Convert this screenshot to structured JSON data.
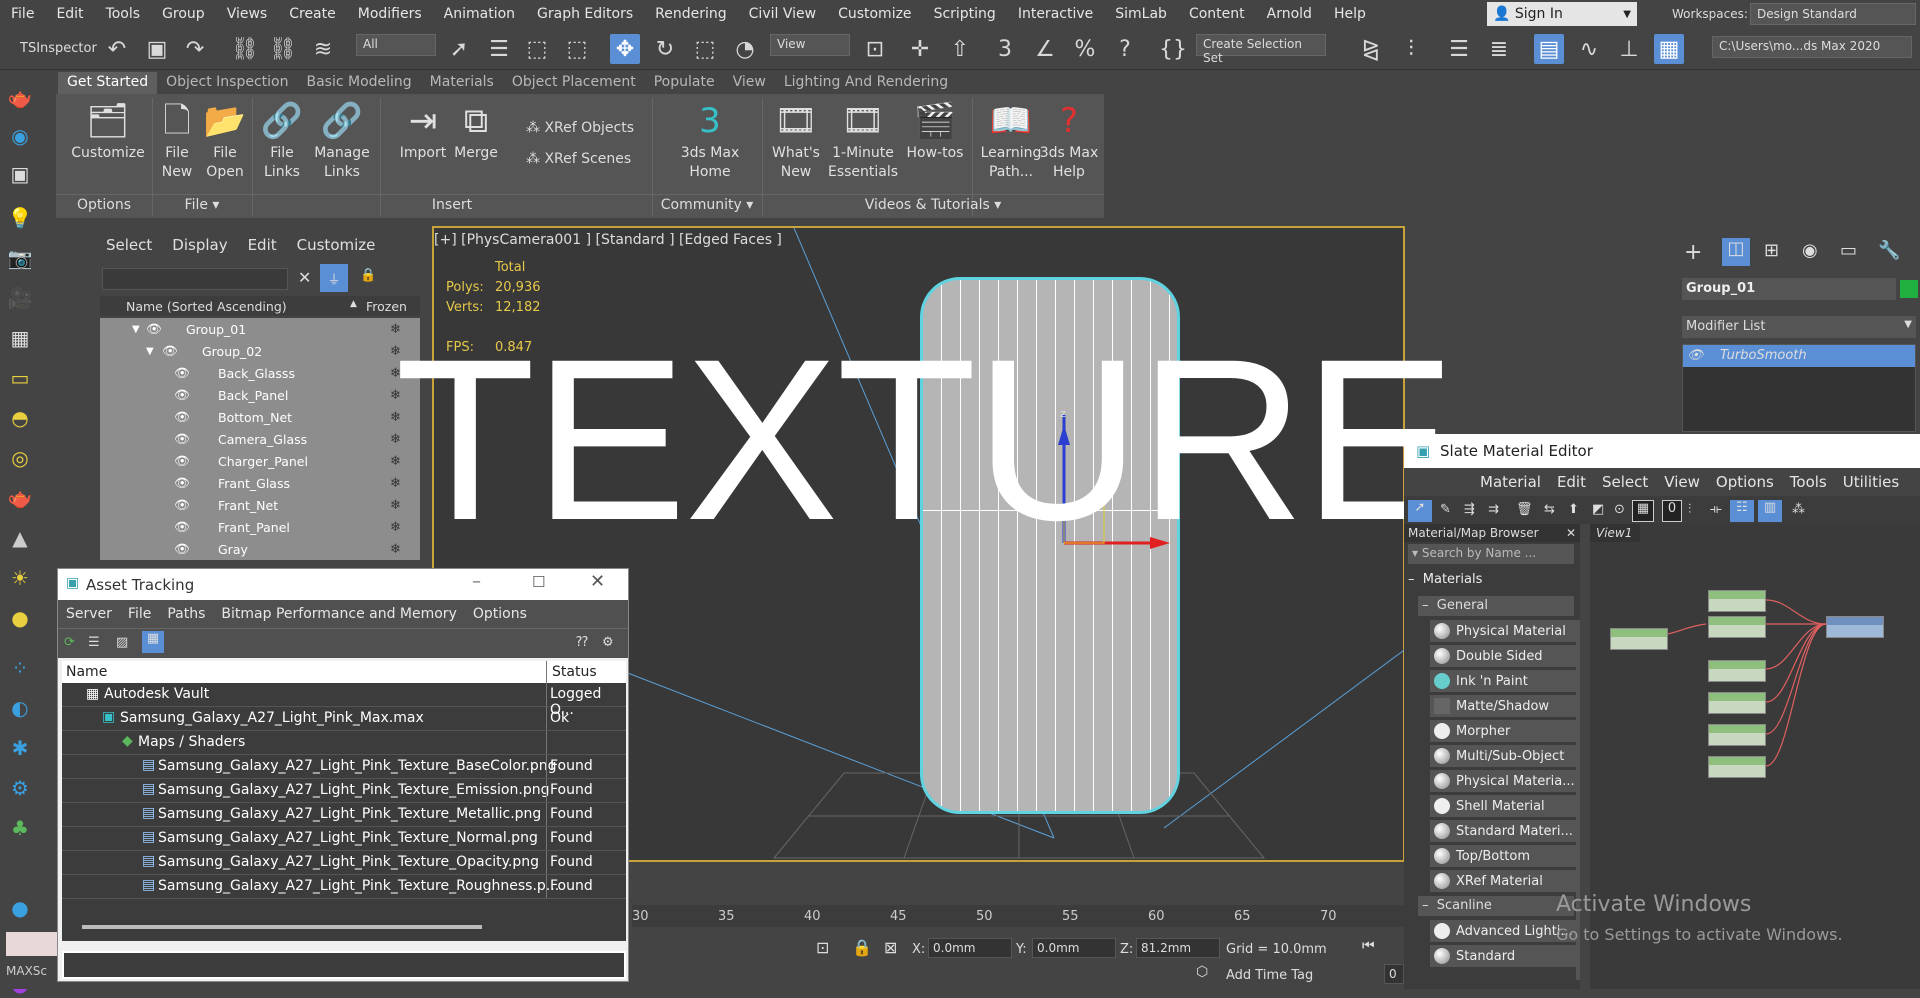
{
  "menubar": {
    "items": [
      "File",
      "Edit",
      "Tools",
      "Group",
      "Views",
      "Create",
      "Modifiers",
      "Animation",
      "Graph Editors",
      "Rendering",
      "Civil View",
      "Customize",
      "Scripting",
      "Interactive",
      "SimLab",
      "Content",
      "Arnold",
      "Help"
    ],
    "signin": "Sign In",
    "workspaces_label": "Workspaces:",
    "workspace": "Design Standard"
  },
  "toolbar": {
    "inspector": "TSInspector",
    "filter": "All",
    "view": "View",
    "selection_set": "Create Selection Set",
    "path": "C:\\Users\\mo...ds Max 2020"
  },
  "ribbon": {
    "tabs": [
      "Get Started",
      "Object Inspection",
      "Basic Modeling",
      "Materials",
      "Object Placement",
      "Populate",
      "View",
      "Lighting And Rendering"
    ],
    "buttons": {
      "customize": "Customize",
      "file_new": "File\nNew",
      "file_open": "File\nOpen",
      "file_links": "File\nLinks",
      "manage_links": "Manage\nLinks",
      "import": "Import",
      "merge": "Merge",
      "xref_objects": "XRef Objects",
      "xref_scenes": "XRef Scenes",
      "max_home": "3ds Max\nHome",
      "whats_new": "What's\nNew",
      "essentials": "1-Minute\nEssentials",
      "howtos": "How-tos",
      "learning": "Learning\nPath...",
      "help": "3ds Max\nHelp"
    },
    "groups": {
      "options": "Options",
      "file": "File ▾",
      "insert": "Insert",
      "community": "Community ▾",
      "videos": "Videos & Tutorials ▾"
    }
  },
  "scene": {
    "menu": [
      "Select",
      "Display",
      "Edit",
      "Customize"
    ],
    "col_name": "Name (Sorted Ascending)",
    "col_frozen": "Frozen",
    "rows": [
      "Group_01",
      "Group_02",
      "Back_Glasss",
      "Back_Panel",
      "Bottom_Net",
      "Camera_Glass",
      "Charger_Panel",
      "Frant_Glass",
      "Frant_Net",
      "Frant_Panel",
      "Gray"
    ]
  },
  "viewport": {
    "label": "[+] [PhysCamera001 ] [Standard ] [Edged Faces ]",
    "total": "Total",
    "polys_label": "Polys:",
    "polys": "20,936",
    "verts_label": "Verts:",
    "verts": "12,182",
    "fps_label": "FPS:",
    "fps": "0.847",
    "watermark": "TEXTURE"
  },
  "ruler": [
    "30",
    "35",
    "40",
    "45",
    "50",
    "55",
    "60",
    "65",
    "70"
  ],
  "status": {
    "x_label": "X:",
    "x": "0.0mm",
    "y_label": "Y:",
    "y": "0.0mm",
    "z_label": "Z:",
    "z": "81.2mm",
    "grid": "Grid = 10.0mm",
    "add_time_tag": "Add Time Tag",
    "maxscript": "MAXSc",
    "frame": "0"
  },
  "cmdpanel": {
    "object_name": "Group_01",
    "modifier_list": "Modifier List",
    "modifier": "TurboSmooth"
  },
  "asset": {
    "title": "Asset Tracking",
    "menu": [
      "Server",
      "File",
      "Paths",
      "Bitmap Performance and Memory",
      "Options"
    ],
    "col_name": "Name",
    "col_status": "Status",
    "rows": [
      {
        "name": "Autodesk Vault",
        "status": "Logged O..."
      },
      {
        "name": "Samsung_Galaxy_A27_Light_Pink_Max.max",
        "status": "Ok"
      },
      {
        "name": "Maps / Shaders",
        "status": ""
      },
      {
        "name": "Samsung_Galaxy_A27_Light_Pink_Texture_BaseColor.png",
        "status": "Found"
      },
      {
        "name": "Samsung_Galaxy_A27_Light_Pink_Texture_Emission.png",
        "status": "Found"
      },
      {
        "name": "Samsung_Galaxy_A27_Light_Pink_Texture_Metallic.png",
        "status": "Found"
      },
      {
        "name": "Samsung_Galaxy_A27_Light_Pink_Texture_Normal.png",
        "status": "Found"
      },
      {
        "name": "Samsung_Galaxy_A27_Light_Pink_Texture_Opacity.png",
        "status": "Found"
      },
      {
        "name": "Samsung_Galaxy_A27_Light_Pink_Texture_Roughness.p...",
        "status": "Found"
      }
    ]
  },
  "slate": {
    "title": "Slate Material Editor",
    "menu": [
      "Material",
      "Edit",
      "Select",
      "View",
      "Options",
      "Tools",
      "Utilities"
    ],
    "browser": "Material/Map Browser",
    "search": "Search by Name ...",
    "view": "View1",
    "materials": "Materials",
    "general": "General",
    "scanline": "Scanline",
    "general_items": [
      "Physical Material",
      "Double Sided",
      "Ink 'n Paint",
      "Matte/Shadow",
      "Morpher",
      "Multi/Sub-Object",
      "Physical Materia...",
      "Shell Material",
      "Standard  Materi...",
      "Top/Bottom",
      "XRef Material"
    ],
    "scanline_items": [
      "Advanced  Lighti...",
      "Standard"
    ],
    "toolbar_num": "0"
  },
  "activate": {
    "line1": "Activate Windows",
    "line2": "Go to Settings to activate Windows."
  }
}
